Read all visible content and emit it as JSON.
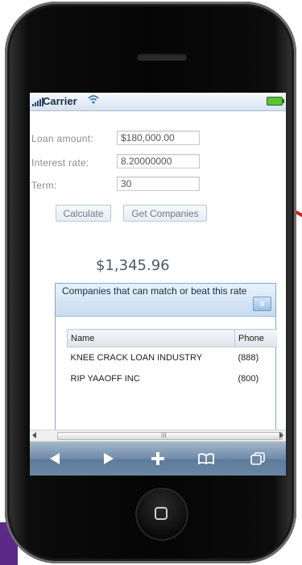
{
  "status_bar": {
    "carrier": "Carrier"
  },
  "form": {
    "loan_amount": {
      "label": "Loan amount:",
      "value": "$180,000.00"
    },
    "interest_rate": {
      "label": "Interest rate:",
      "value": "8.20000000"
    },
    "term": {
      "label": "Term:",
      "value": "30"
    }
  },
  "buttons": {
    "calculate": "Calculate",
    "get_companies": "Get Companies"
  },
  "result": "$1,345.96",
  "dialog": {
    "title": "Companies that can match or beat this rate",
    "close": "x",
    "columns": [
      "Name",
      "Phone"
    ],
    "rows": [
      {
        "name": "KNEE CRACK LOAN INDUSTRY",
        "phone": "(888)"
      },
      {
        "name": "RIP YAAOFF INC",
        "phone": "(800)"
      }
    ]
  },
  "scrollbar": {
    "grip": "III"
  },
  "toolbar": {
    "items": [
      "back-icon",
      "forward-icon",
      "add-icon",
      "bookmarks-icon",
      "pages-icon"
    ]
  },
  "colors": {
    "accent": "#7da7d9",
    "toolbar": "#6e89a8"
  }
}
